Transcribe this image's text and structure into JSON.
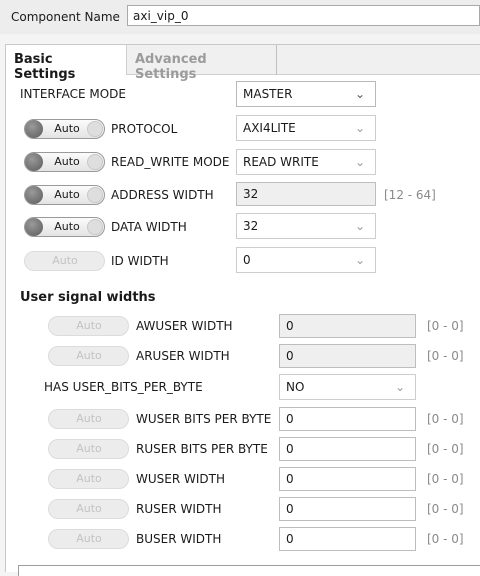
{
  "header": {
    "component_label": "Component Name",
    "component_value": "axi_vip_0"
  },
  "tabs": [
    {
      "label": "Basic Settings"
    },
    {
      "label": "Advanced Settings"
    }
  ],
  "basic": {
    "interface_mode_label": "INTERFACE MODE",
    "interface_mode_value": "MASTER",
    "rows": [
      {
        "toggle": "Auto",
        "label": "PROTOCOL",
        "value": "AXI4LITE"
      },
      {
        "toggle": "Auto",
        "label": "READ_WRITE MODE",
        "value": "READ WRITE"
      },
      {
        "toggle": "Auto",
        "label": "ADDRESS WIDTH",
        "value": "32",
        "range": "[12 - 64]"
      },
      {
        "toggle": "Auto",
        "label": "DATA WIDTH",
        "value": "32"
      },
      {
        "toggle": "Auto",
        "label": "ID WIDTH",
        "value": "0"
      }
    ]
  },
  "user_signals": {
    "title": "User signal widths",
    "rows": [
      {
        "toggle": "Auto",
        "label": "AWUSER WIDTH",
        "value": "0",
        "range": "[0 - 0]"
      },
      {
        "toggle": "Auto",
        "label": "ARUSER WIDTH",
        "value": "0",
        "range": "[0 - 0]"
      },
      {
        "label": "HAS USER_BITS_PER_BYTE",
        "value": "NO"
      },
      {
        "toggle": "Auto",
        "label": "WUSER BITS PER BYTE",
        "value": "0",
        "range": "[0 - 0]"
      },
      {
        "toggle": "Auto",
        "label": "RUSER BITS PER BYTE",
        "value": "0",
        "range": "[0 - 0]"
      },
      {
        "toggle": "Auto",
        "label": "WUSER WIDTH",
        "value": "0",
        "range": "[0 - 0]"
      },
      {
        "toggle": "Auto",
        "label": "RUSER WIDTH",
        "value": "0",
        "range": "[0 - 0]"
      },
      {
        "toggle": "Auto",
        "label": "BUSER WIDTH",
        "value": "0",
        "range": "[0 - 0]"
      }
    ]
  },
  "icons": {
    "dropdown": "chevron-down-icon"
  }
}
